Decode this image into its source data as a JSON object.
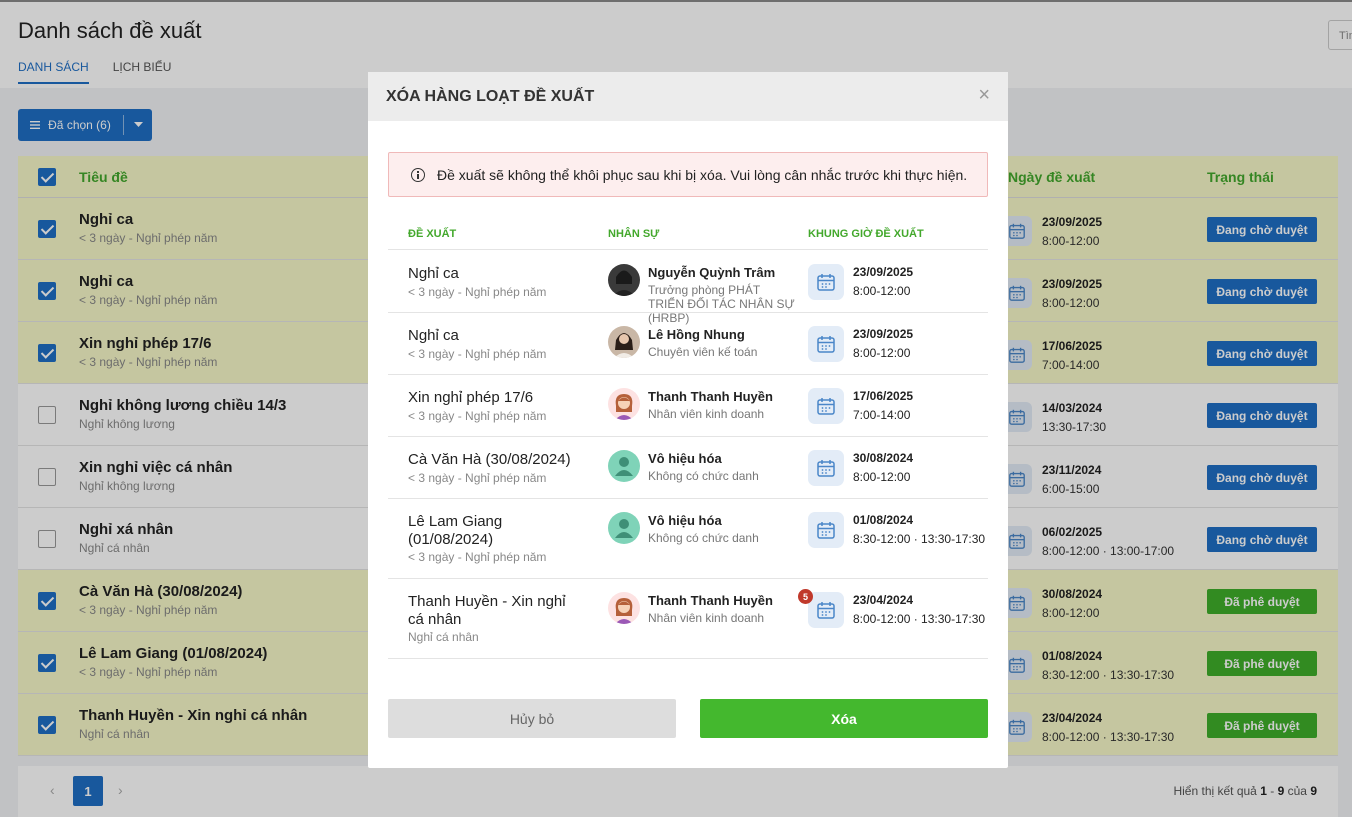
{
  "page": {
    "title": "Danh sách đề xuất",
    "tabs": [
      "DANH SÁCH",
      "LỊCH BIỂU"
    ],
    "search_placeholder": "Tìm",
    "selected_button": "Đã chọn (6)"
  },
  "table": {
    "headers": {
      "title": "Tiêu đề",
      "date": "Ngày đề xuất",
      "status": "Trạng thái"
    },
    "rows": [
      {
        "title": "Nghỉ ca",
        "sub": "< 3 ngày - Nghỉ phép năm",
        "checked": true,
        "date": "23/09/2025",
        "time": "8:00-12:00",
        "status": "Đang chờ duyệt",
        "status_type": "pending"
      },
      {
        "title": "Nghỉ ca",
        "sub": "< 3 ngày - Nghỉ phép năm",
        "checked": true,
        "date": "23/09/2025",
        "time": "8:00-12:00",
        "status": "Đang chờ duyệt",
        "status_type": "pending"
      },
      {
        "title": "Xin nghỉ phép 17/6",
        "sub": "< 3 ngày - Nghỉ phép năm",
        "checked": true,
        "date": "17/06/2025",
        "time": "7:00-14:00",
        "status": "Đang chờ duyệt",
        "status_type": "pending"
      },
      {
        "title": "Nghỉ không lương chiều 14/3",
        "sub": "Nghỉ không lương",
        "checked": false,
        "date": "14/03/2024",
        "time": "13:30-17:30",
        "status": "Đang chờ duyệt",
        "status_type": "pending"
      },
      {
        "title": "Xin nghỉ việc cá nhân",
        "sub": "Nghỉ không lương",
        "checked": false,
        "date": "23/11/2024",
        "time": "6:00-15:00",
        "status": "Đang chờ duyệt",
        "status_type": "pending"
      },
      {
        "title": "Nghỉ xá nhân",
        "sub": "Nghỉ cá nhân",
        "checked": false,
        "date": "06/02/2025",
        "time": "8:00-12:00 · 13:00-17:00",
        "status": "Đang chờ duyệt",
        "status_type": "pending"
      },
      {
        "title": "Cà Văn Hà (30/08/2024)",
        "sub": "< 3 ngày - Nghỉ phép năm",
        "checked": true,
        "date": "30/08/2024",
        "time": "8:00-12:00",
        "status": "Đã phê duyệt",
        "status_type": "approved"
      },
      {
        "title": "Lê Lam Giang (01/08/2024)",
        "sub": "< 3 ngày - Nghỉ phép năm",
        "checked": true,
        "date": "01/08/2024",
        "time": "8:30-12:00 · 13:30-17:30",
        "status": "Đã phê duyệt",
        "status_type": "approved"
      },
      {
        "title": "Thanh Huyền - Xin nghỉ cá nhân",
        "sub": "Nghỉ cá nhân",
        "checked": true,
        "date": "23/04/2024",
        "time": "8:00-12:00 · 13:30-17:30",
        "status": "Đã phê duyệt",
        "status_type": "approved"
      }
    ]
  },
  "pagination": {
    "prev": "‹",
    "page": "1",
    "next": "›",
    "info_prefix": "Hiển thị kết quả",
    "from": "1",
    "dash": "-",
    "to": "9",
    "of": "của",
    "total": "9"
  },
  "modal": {
    "title": "XÓA HÀNG LOẠT ĐỀ XUẤT",
    "close": "×",
    "warning": "Đề xuất sẽ không thể khôi phục sau khi bị xóa. Vui lòng cân nhắc trước khi thực hiện.",
    "columns": {
      "proposal": "ĐỀ XUẤT",
      "staff": "NHÂN SỰ",
      "slot": "KHUNG GIỜ ĐỀ XUẤT"
    },
    "rows": [
      {
        "title": "Nghỉ ca",
        "sub": "< 3 ngày - Nghỉ phép năm",
        "name": "Nguyễn Quỳnh Trâm",
        "role": "Trưởng phòng PHÁT TRIỂN ĐỐI TÁC NHÂN SỰ (HRBP)",
        "avatar": "photo-dark",
        "date": "23/09/2025",
        "time": "8:00-12:00",
        "badge": ""
      },
      {
        "title": "Nghỉ ca",
        "sub": "< 3 ngày - Nghỉ phép năm",
        "name": "Lê Hồng Nhung",
        "role": "Chuyên viên kế toán",
        "avatar": "photo-light",
        "date": "23/09/2025",
        "time": "8:00-12:00",
        "badge": ""
      },
      {
        "title": "Xin nghỉ phép 17/6",
        "sub": "< 3 ngày - Nghỉ phép năm",
        "name": "Thanh Thanh Huyền",
        "role": "Nhân viên kinh doanh",
        "avatar": "cartoon-woman",
        "date": "17/06/2025",
        "time": "7:00-14:00",
        "badge": ""
      },
      {
        "title": "Cà Văn Hà (30/08/2024)",
        "sub": "< 3 ngày - Nghỉ phép năm",
        "name": "Vô hiệu hóa",
        "role": "Không có chức danh",
        "avatar": "default-person",
        "date": "30/08/2024",
        "time": "8:00-12:00",
        "badge": ""
      },
      {
        "title": "Lê Lam Giang (01/08/2024)",
        "sub": "< 3 ngày - Nghỉ phép năm",
        "name": "Vô hiệu hóa",
        "role": "Không có chức danh",
        "avatar": "default-person",
        "date": "01/08/2024",
        "time": "8:30-12:00 · 13:30-17:30",
        "badge": ""
      },
      {
        "title": "Thanh Huyền - Xin nghỉ cá nhân",
        "sub": "Nghỉ cá nhân",
        "name": "Thanh Thanh Huyền",
        "role": "Nhân viên kinh doanh",
        "avatar": "cartoon-woman",
        "date": "23/04/2024",
        "time": "8:00-12:00 · 13:30-17:30",
        "badge": "5"
      }
    ],
    "cancel": "Hủy bỏ",
    "confirm": "Xóa"
  },
  "colors": {
    "primary": "#1f6fc5",
    "success": "#44b82e",
    "header_green": "#43a82c",
    "row_highlight": "#f7f8c9"
  }
}
